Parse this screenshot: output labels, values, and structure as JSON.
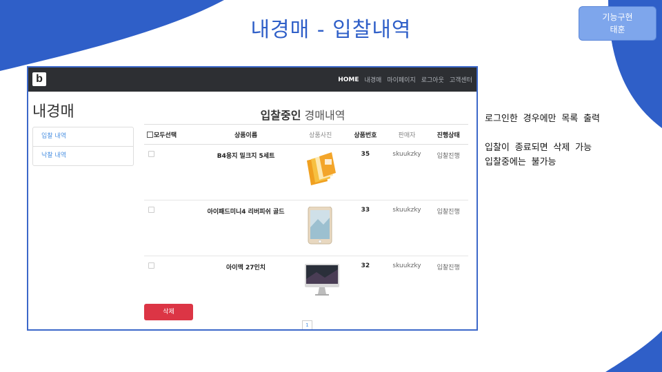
{
  "slide": {
    "title": "내경매 - 입찰내역",
    "badge_line1": "기능구현",
    "badge_line2": "태훈",
    "accent_color": "#2f5fc8",
    "notes": [
      "로그인한 경우에만 목록 출력",
      "",
      "입찰이 종료되면 삭제 가능",
      "입찰중에는 불가능"
    ]
  },
  "app": {
    "brand": "b",
    "nav": [
      "HOME",
      "내경매",
      "마이페이지",
      "로그아웃",
      "고객센터"
    ],
    "page_title": "내경매",
    "sidebar": [
      "입찰 내역",
      "낙찰 내역"
    ],
    "heading_strong": "입찰중인",
    "heading_light": "경매내역",
    "columns": [
      "모두선택",
      "상품이름",
      "상품사진",
      "상품번호",
      "판매자",
      "진행상태"
    ],
    "rows": [
      {
        "name": "B4용지 밀크지 5세트",
        "image": "paper-ream-image",
        "number": "35",
        "seller": "skuukzky",
        "status": "입찰진행"
      },
      {
        "name": "아이패드미니4 리버피쉬 골드",
        "image": "ipad-image",
        "number": "33",
        "seller": "skuukzky",
        "status": "입찰진행"
      },
      {
        "name": "아이맥 27인치",
        "image": "imac-image",
        "number": "32",
        "seller": "skuukzky",
        "status": "입찰진행"
      }
    ],
    "delete_label": "삭제",
    "page_number": "1",
    "delete_color": "#dc3545"
  }
}
